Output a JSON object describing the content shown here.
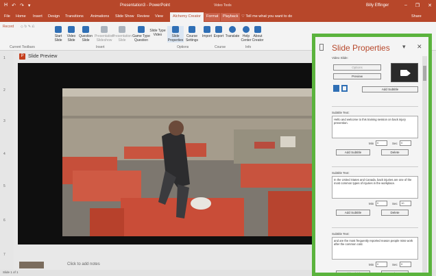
{
  "titlebar": {
    "title": "Presentation3 - PowerPoint",
    "context": "Video Tools",
    "user": "Billy Effinger",
    "qat": [
      "H",
      "↶",
      "↷",
      "▾"
    ]
  },
  "tabs": [
    "File",
    "Home",
    "Insert",
    "Design",
    "Transitions",
    "Animations",
    "Slide Show",
    "Review",
    "View",
    "Alchemy Creator",
    "Format",
    "Playback",
    "♡ Tell me what you want to do"
  ],
  "share": "Share",
  "ribbon": {
    "toolbars_label": "Record",
    "items": [
      {
        "l1": "Start",
        "l2": "Slide"
      },
      {
        "l1": "Video",
        "l2": "Slide"
      },
      {
        "l1": "Question",
        "l2": "Slide"
      },
      {
        "l1": "Presentation",
        "l2": "Slideshow"
      },
      {
        "l1": "Presentation",
        "l2": "Slide"
      },
      {
        "l1": "Game Type",
        "l2": "Question"
      },
      {
        "l1": "Slide Type",
        "l2": "Video"
      },
      {
        "l1": "Slide",
        "l2": "Properties"
      },
      {
        "l1": "Course",
        "l2": "Settings"
      },
      {
        "l1": "Import",
        "l2": ""
      },
      {
        "l1": "Export",
        "l2": ""
      },
      {
        "l1": "Translate",
        "l2": ""
      },
      {
        "l1": "Help",
        "l2": "Center"
      },
      {
        "l1": "About",
        "l2": "Creator"
      }
    ],
    "groups": [
      "Current Toolbars",
      "Insert",
      "Options",
      "Course",
      "Info"
    ]
  },
  "rail_numbers": [
    "1",
    "2",
    "3",
    "4",
    "5",
    "6",
    "7"
  ],
  "preview": {
    "label": "Slide Preview"
  },
  "notes": {
    "placeholder": "Click to add notes"
  },
  "status": {
    "text": "Slide 1 of 1"
  },
  "panel": {
    "title": "Slide Properties",
    "dropdown_icon": "▾",
    "close_icon": "✕",
    "video_slide_label": "Video Slide:",
    "options_btn": "Options",
    "preview_btn": "Preview",
    "add_subtitle_top": "Add Subtitle",
    "subtitles": [
      {
        "label": "Subtitle Text:",
        "text": "Hello and welcome to this training session on back injury prevention.",
        "min_label": "Min",
        "min": "0",
        "sec_label": "Sec",
        "sec": "0",
        "add": "Add Subtitle",
        "delete": "Delete"
      },
      {
        "label": "Subtitle Text:",
        "text": "In the United States and Canada, back injuries are one of the most common types of injuries in the workplace.",
        "min_label": "Min",
        "min": "0",
        "sec_label": "Sec",
        "sec": "10",
        "add": "Add Subtitle",
        "delete": "Delete"
      },
      {
        "label": "Subtitle Text:",
        "text": "and are the most frequently reported reason people miss work after the common cold.",
        "min_label": "Min",
        "min": "0",
        "sec_label": "Sec",
        "sec": "0",
        "add": "Add Subtitle",
        "delete": "Delete"
      }
    ]
  },
  "colors": {
    "accent": "#b7472a",
    "panel_border": "#5bb33d"
  }
}
